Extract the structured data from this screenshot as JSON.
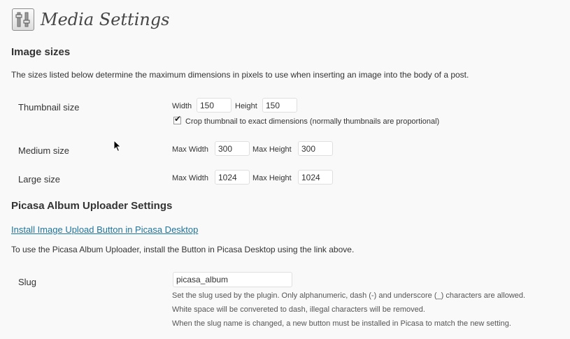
{
  "header": {
    "title": "Media Settings",
    "icon": "settings-sliders-icon"
  },
  "image_sizes": {
    "heading": "Image sizes",
    "description": "The sizes listed below determine the maximum dimensions in pixels to use when inserting an image into the body of a post.",
    "thumbnail": {
      "label": "Thumbnail size",
      "width_label": "Width",
      "width_value": "150",
      "height_label": "Height",
      "height_value": "150",
      "crop_checked": true,
      "crop_label": "Crop thumbnail to exact dimensions (normally thumbnails are proportional)"
    },
    "medium": {
      "label": "Medium size",
      "max_width_label": "Max Width",
      "max_width_value": "300",
      "max_height_label": "Max Height",
      "max_height_value": "300"
    },
    "large": {
      "label": "Large size",
      "max_width_label": "Max Width",
      "max_width_value": "1024",
      "max_height_label": "Max Height",
      "max_height_value": "1024"
    }
  },
  "picasa": {
    "heading": "Picasa Album Uploader Settings",
    "install_link": "Install Image Upload Button in Picasa Desktop",
    "description": "To use the Picasa Album Uploader, install the Button in Picasa Desktop using the link above.",
    "slug": {
      "label": "Slug",
      "value": "picasa_album",
      "help_1": "Set the slug used by the plugin. Only alphanumeric, dash (-) and underscore (_) characters are allowed.",
      "help_2": "White space will be convereted to dash, illegal characters will be removed.",
      "help_3": "When the slug name is changed, a new button must be installed in Picasa to match the new setting."
    }
  },
  "colors": {
    "link": "#21759b",
    "background": "#f9f9f9",
    "text": "#333333"
  }
}
